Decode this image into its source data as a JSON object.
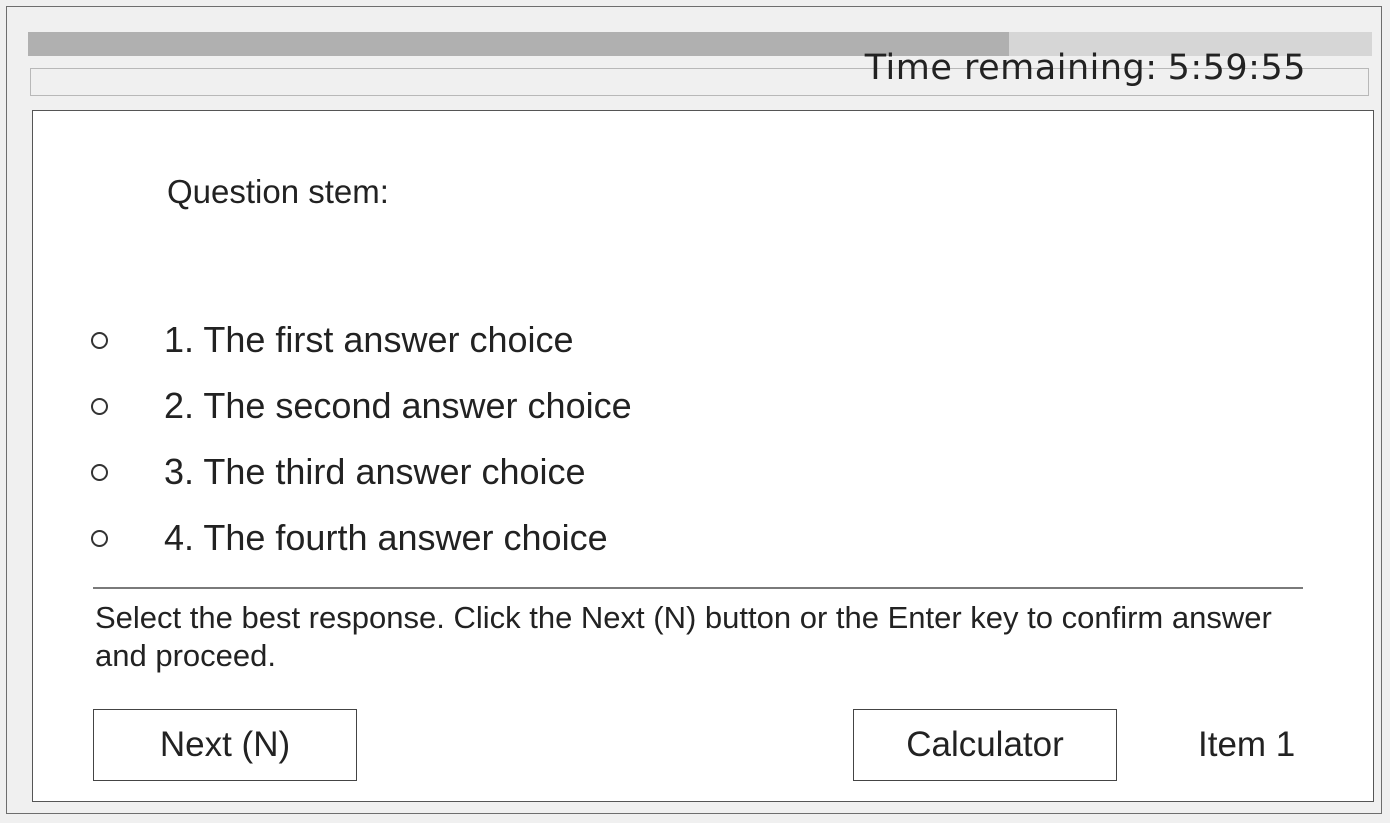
{
  "progress": {
    "fraction": 0.73
  },
  "timer": {
    "label": "Time remaining:",
    "value": "5:59:55"
  },
  "question": {
    "stem": "Question stem:"
  },
  "choices": [
    {
      "label": "1. The first answer choice"
    },
    {
      "label": "2. The second answer choice"
    },
    {
      "label": "3. The third answer choice"
    },
    {
      "label": "4. The fourth answer choice"
    }
  ],
  "instructions": "Select the best response. Click the Next (N) button or the Enter key to confirm answer and proceed.",
  "buttons": {
    "next": "Next (N)",
    "calculator": "Calculator"
  },
  "item": {
    "label": "Item 1"
  }
}
